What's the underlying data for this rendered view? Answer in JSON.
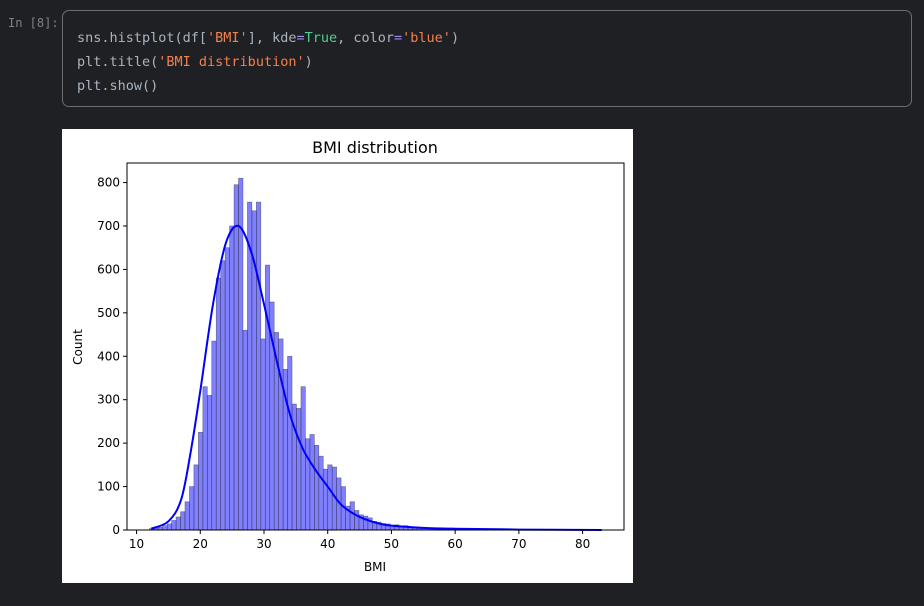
{
  "cell": {
    "prompt": "In [8]:",
    "code": {
      "l1_a": "sns.histplot(df[",
      "l1_s1": "'BMI'",
      "l1_b": "], kde",
      "l1_eq1": "=",
      "l1_kw": "True",
      "l1_c": ", color",
      "l1_eq2": "=",
      "l1_s2": "'blue'",
      "l1_d": ")",
      "l2_a": "plt.title(",
      "l2_s": "'BMI distribution'",
      "l2_b": ")",
      "l3": "plt.show()"
    }
  },
  "chart_data": {
    "type": "bar",
    "title": "BMI distribution",
    "xlabel": "BMI",
    "ylabel": "Count",
    "xlim": [
      8.5,
      86.5
    ],
    "ylim": [
      0,
      845
    ],
    "xticks": [
      10,
      20,
      30,
      40,
      50,
      60,
      70,
      80
    ],
    "yticks": [
      0,
      100,
      200,
      300,
      400,
      500,
      600,
      700,
      800
    ],
    "grid": false,
    "colors": {
      "bar_fill": "#0000ff",
      "bar_alpha": 0.5,
      "bar_edge": "#333333",
      "kde_line": "#0000ff"
    },
    "bin_start": 12.0,
    "bin_width": 0.7,
    "counts": [
      3,
      4,
      6,
      10,
      14,
      22,
      30,
      42,
      65,
      100,
      150,
      225,
      330,
      310,
      435,
      580,
      620,
      650,
      700,
      795,
      810,
      460,
      755,
      735,
      755,
      440,
      610,
      525,
      455,
      440,
      370,
      400,
      290,
      280,
      330,
      210,
      220,
      195,
      170,
      140,
      150,
      145,
      120,
      100,
      55,
      65,
      45,
      35,
      32,
      28,
      20,
      18,
      15,
      14,
      11,
      12,
      8,
      10,
      6,
      5,
      4,
      4,
      3,
      3,
      3,
      2,
      2,
      3,
      2,
      1,
      2,
      1,
      1,
      2,
      1,
      1,
      1,
      0,
      1,
      1,
      0,
      1,
      0,
      1,
      0,
      0,
      1,
      0,
      0,
      1,
      0,
      0,
      0,
      1,
      0,
      0,
      0,
      0,
      1,
      0,
      0
    ],
    "kde": {
      "x": [
        12.3,
        15,
        17,
        18.5,
        20,
        22,
        24,
        26,
        28,
        30,
        32,
        34,
        36,
        38,
        40,
        42,
        44,
        46,
        48,
        50,
        55,
        60,
        70,
        83
      ],
      "y": [
        3,
        20,
        70,
        180,
        320,
        520,
        660,
        700,
        640,
        520,
        390,
        270,
        190,
        140,
        100,
        60,
        38,
        24,
        15,
        10,
        5,
        3,
        1,
        0
      ]
    }
  }
}
